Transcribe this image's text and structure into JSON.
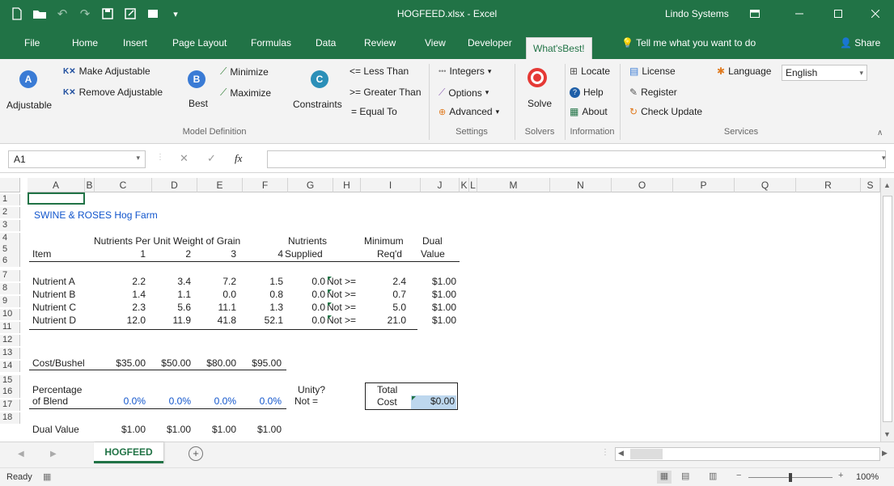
{
  "window": {
    "title": "HOGFEED.xlsx - Excel",
    "user": "Lindo Systems"
  },
  "tabs": [
    "File",
    "Home",
    "Insert",
    "Page Layout",
    "Formulas",
    "Data",
    "Review",
    "View",
    "Developer",
    "What'sBest!"
  ],
  "tell_me": "Tell me what you want to do",
  "share_label": "Share",
  "ribbon": {
    "adjustable": "Adjustable",
    "make_adjustable": "Make Adjustable",
    "remove_adjustable": "Remove Adjustable",
    "best": "Best",
    "minimize": "Minimize",
    "maximize": "Maximize",
    "constraints": "Constraints",
    "less_than": "<= Less Than",
    "greater_than": ">= Greater Than",
    "equal_to": "= Equal To",
    "model_definition": "Model Definition",
    "integers": "Integers",
    "options": "Options",
    "advanced": "Advanced",
    "settings": "Settings",
    "solve": "Solve",
    "solvers": "Solvers",
    "locate": "Locate",
    "help": "Help",
    "about": "About",
    "information": "Information",
    "license": "License",
    "register": "Register",
    "check_update": "Check Update",
    "language": "Language",
    "language_value": "English",
    "services": "Services"
  },
  "formula_bar": {
    "name_box": "A1",
    "fx": "fx",
    "formula": ""
  },
  "columns": [
    "A",
    "B",
    "C",
    "D",
    "E",
    "F",
    "G",
    "H",
    "I",
    "J",
    "K",
    "L",
    "M",
    "N",
    "O",
    "P",
    "Q",
    "R",
    "S"
  ],
  "rows": [
    "1",
    "2",
    "3",
    "4",
    "5",
    "6",
    "7",
    "8",
    "9",
    "10",
    "11",
    "12",
    "13",
    "14",
    "15",
    "16",
    "17",
    "18"
  ],
  "sheet": {
    "title": "SWINE & ROSES Hog Farm",
    "nutrients_header": "Nutrients Per Unit Weight of Grain",
    "nutrients_col": "Nutrients",
    "supplied": "Supplied",
    "minimum": "Minimum",
    "reqd": "Req'd",
    "dual": "Dual",
    "value": "Value",
    "item": "Item",
    "grain_nums": [
      "1",
      "2",
      "3",
      "4"
    ],
    "nutrient_rows": [
      {
        "name": "Nutrient A",
        "vals": [
          "2.2",
          "3.4",
          "7.2",
          "1.5"
        ],
        "supplied": "0.0",
        "rel": "Not >=",
        "min": "2.4",
        "dual": "$1.00"
      },
      {
        "name": "Nutrient B",
        "vals": [
          "1.4",
          "1.1",
          "0.0",
          "0.8"
        ],
        "supplied": "0.0",
        "rel": "Not >=",
        "min": "0.7",
        "dual": "$1.00"
      },
      {
        "name": "Nutrient C",
        "vals": [
          "2.3",
          "5.6",
          "11.1",
          "1.3"
        ],
        "supplied": "0.0",
        "rel": "Not >=",
        "min": "5.0",
        "dual": "$1.00"
      },
      {
        "name": "Nutrient D",
        "vals": [
          "12.0",
          "11.9",
          "41.8",
          "52.1"
        ],
        "supplied": "0.0",
        "rel": "Not >=",
        "min": "21.0",
        "dual": "$1.00"
      }
    ],
    "cost_label": "Cost/Bushel",
    "costs": [
      "$35.00",
      "$50.00",
      "$80.00",
      "$95.00"
    ],
    "percentage": "Percentage",
    "of_blend": "of Blend",
    "blend": [
      "0.0%",
      "0.0%",
      "0.0%",
      "0.0%"
    ],
    "unity": "Unity?",
    "not_eq": "Not =",
    "total": "Total",
    "cost": "Cost",
    "total_cost": "$0.00",
    "dual_value_label": "Dual Value",
    "dual_values": [
      "$1.00",
      "$1.00",
      "$1.00",
      "$1.00"
    ]
  },
  "sheet_tab": "HOGFEED",
  "status": {
    "ready": "Ready",
    "zoom": "100%"
  },
  "colors": {
    "excel_green": "#217346",
    "selected_cell": "#bdd7ee"
  }
}
